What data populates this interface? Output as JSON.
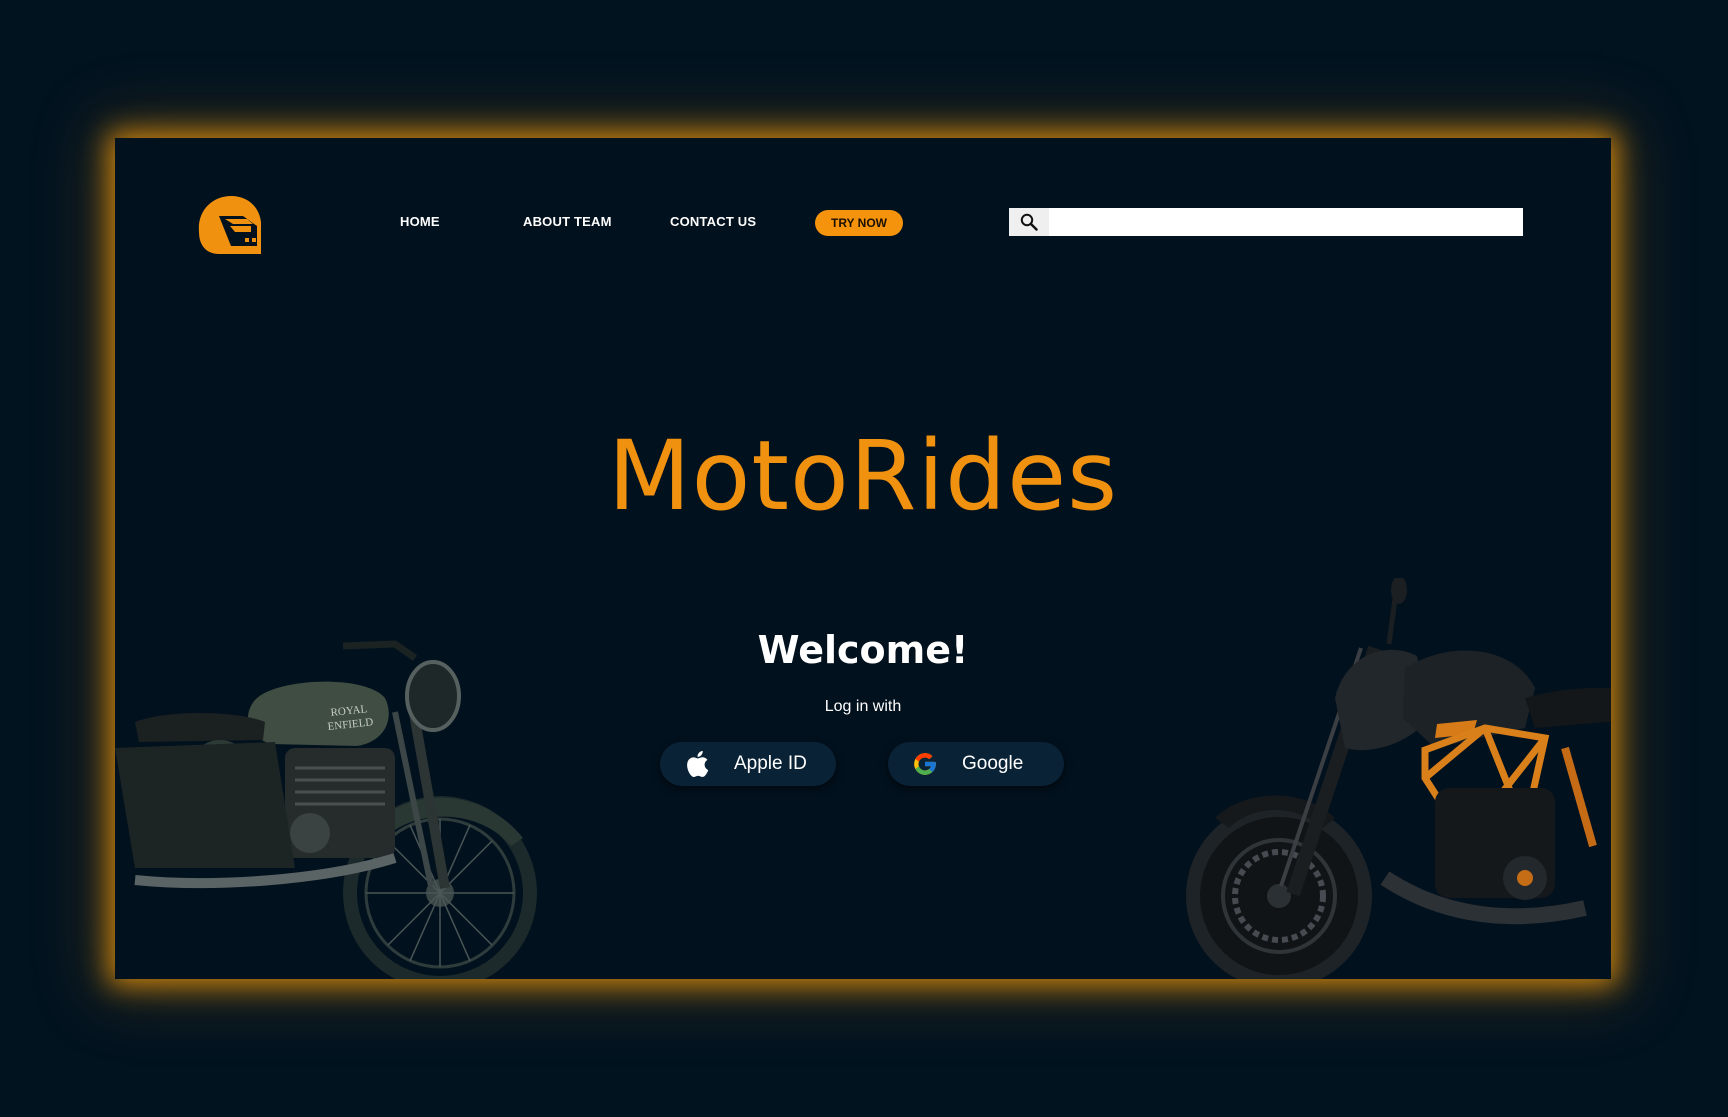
{
  "nav": {
    "home": "HOME",
    "about": "ABOUT TEAM",
    "contact": "CONTACT US",
    "try_now": "TRY NOW"
  },
  "search": {
    "placeholder": "",
    "value": "",
    "icon": "search-icon"
  },
  "hero": {
    "brand": "MotoRides",
    "welcome": "Welcome!",
    "login_with": "Log in with"
  },
  "login": {
    "apple_label": "Apple ID",
    "apple_icon": "apple-icon",
    "google_label": "Google",
    "google_icon": "google-icon"
  },
  "bikes": {
    "left_tank_text_1": "ROYAL",
    "left_tank_text_2": "ENFIELD"
  },
  "colors": {
    "accent": "#f0910f",
    "background": "#021320",
    "frame": "#02111e",
    "button_bg": "#0a2236",
    "text": "#ffffff"
  }
}
